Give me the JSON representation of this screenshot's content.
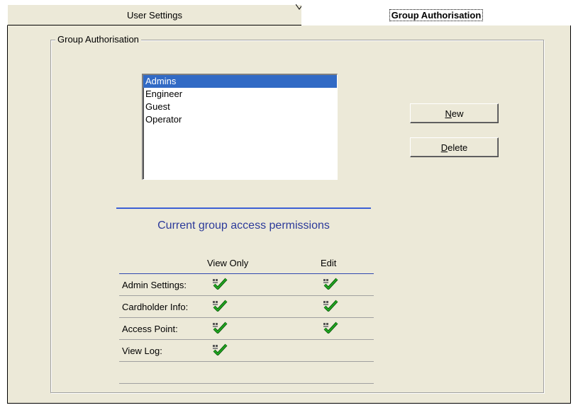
{
  "tabs": [
    {
      "label": "User Settings",
      "active": false
    },
    {
      "label": "Group Authorisation",
      "active": true
    }
  ],
  "groupbox": {
    "legend": "Group Authorisation"
  },
  "groups": {
    "items": [
      "Admins",
      "Engineer",
      "Guest",
      "Operator"
    ],
    "selected": "Admins"
  },
  "buttons": {
    "new_label": "New",
    "new_accel": "N",
    "new_rest": "ew",
    "delete_label": "Delete",
    "delete_accel": "D",
    "delete_rest": "elete"
  },
  "permissions": {
    "title": "Current group access permissions",
    "columns": [
      "View Only",
      "Edit"
    ],
    "rows": [
      {
        "label": "Admin Settings:",
        "view_only": true,
        "edit": true
      },
      {
        "label": "Cardholder Info:",
        "view_only": true,
        "edit": true
      },
      {
        "label": "Access Point:",
        "view_only": true,
        "edit": true
      },
      {
        "label": "View Log:",
        "view_only": true,
        "edit": false
      }
    ]
  },
  "colors": {
    "panel": "#ece9d8",
    "selection": "#316ac5",
    "title_blue": "#2c3a9a",
    "check_green": "#22aa22"
  },
  "icons": {
    "check": "ok-check-icon"
  }
}
